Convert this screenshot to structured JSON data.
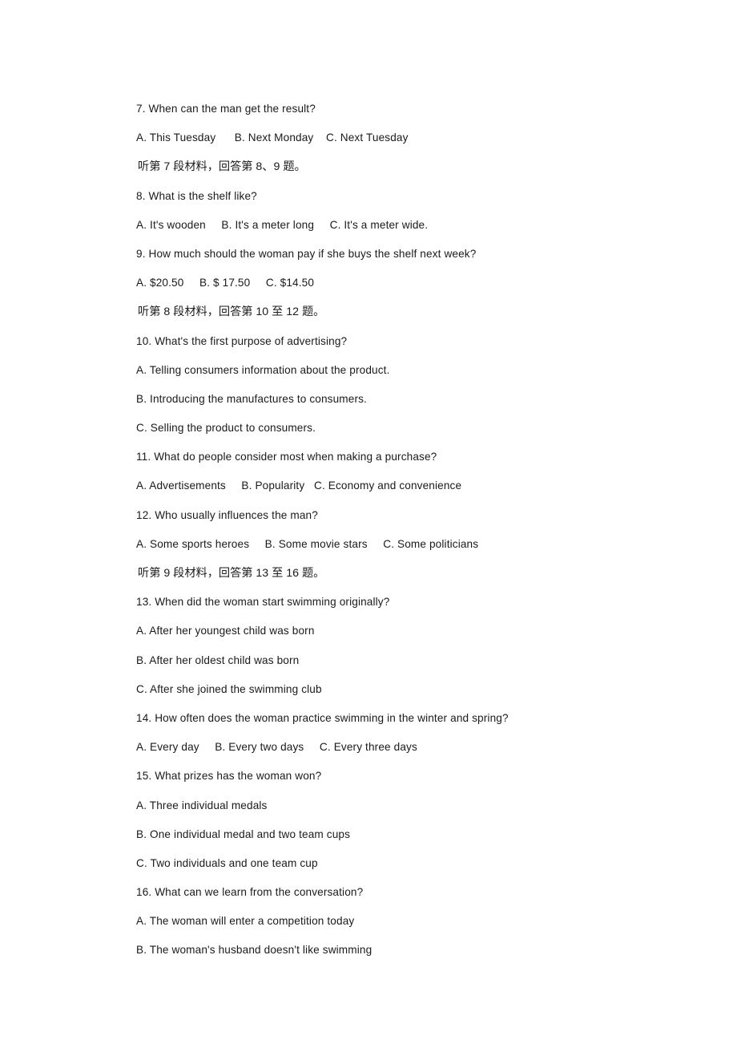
{
  "document": {
    "page_background": "#ffffff",
    "text_color": "#1a1a1a",
    "lines": [
      {
        "kind": "question",
        "text": "7. When can the man get the result?"
      },
      {
        "kind": "options",
        "text": "A. This Tuesday      B. Next Monday    C. Next Tuesday"
      },
      {
        "kind": "instruction",
        "text": "听第 7 段材料，回答第 8、9 题。"
      },
      {
        "kind": "question",
        "text": "8. What is the shelf like?"
      },
      {
        "kind": "options",
        "text": "A. It's wooden     B. It's a meter long     C. It's a meter wide."
      },
      {
        "kind": "question",
        "text": "9. How much should the woman pay if she buys the shelf next week?"
      },
      {
        "kind": "options",
        "text": "A. $20.50     B. $ 17.50     C. $14.50"
      },
      {
        "kind": "instruction",
        "text": "听第 8 段材料，回答第 10 至 12 题。"
      },
      {
        "kind": "question",
        "text": "10. What's the first purpose of advertising?"
      },
      {
        "kind": "options",
        "text": "A. Telling consumers information about the product."
      },
      {
        "kind": "options",
        "text": "B. Introducing the manufactures to consumers."
      },
      {
        "kind": "options",
        "text": "C. Selling the product to consumers."
      },
      {
        "kind": "question",
        "text": "11. What do people consider most when making a purchase?"
      },
      {
        "kind": "options",
        "text": "A. Advertisements     B. Popularity   C. Economy and convenience"
      },
      {
        "kind": "question",
        "text": "12. Who usually influences the man?"
      },
      {
        "kind": "options",
        "text": "A. Some sports heroes     B. Some movie stars     C. Some politicians"
      },
      {
        "kind": "instruction",
        "text": "听第 9 段材料，回答第 13 至 16 题。"
      },
      {
        "kind": "question",
        "text": "13. When did the woman start swimming originally?"
      },
      {
        "kind": "options",
        "text": "A. After her youngest child was born"
      },
      {
        "kind": "options",
        "text": "B. After her oldest child was born"
      },
      {
        "kind": "options",
        "text": "C. After she joined the swimming club"
      },
      {
        "kind": "question",
        "text": "14. How often does the woman practice swimming in the winter and spring?"
      },
      {
        "kind": "options",
        "text": "A. Every day     B. Every two days     C. Every three days"
      },
      {
        "kind": "question",
        "text": "15. What prizes has the woman won?"
      },
      {
        "kind": "options",
        "text": "A. Three individual medals"
      },
      {
        "kind": "options",
        "text": "B. One individual medal and two team cups"
      },
      {
        "kind": "options",
        "text": "C. Two individuals and one team cup"
      },
      {
        "kind": "question",
        "text": "16. What can we learn from the conversation?"
      },
      {
        "kind": "options",
        "text": "A. The woman will enter a competition today"
      },
      {
        "kind": "options",
        "text": "B. The woman's husband doesn't like swimming"
      }
    ]
  }
}
